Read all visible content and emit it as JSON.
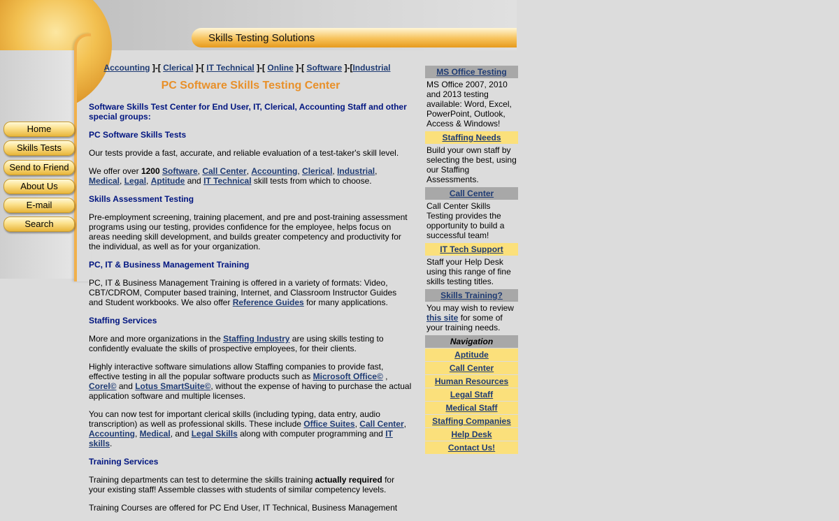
{
  "header": {
    "site_title": "Skills Testing Solutions"
  },
  "left_nav": [
    "Home",
    "Skills Tests",
    "Send to Friend",
    "About Us",
    "E-mail",
    "Search"
  ],
  "top_nav": {
    "items": [
      "Accounting",
      "Clerical",
      "IT Technical",
      "Online",
      "Software",
      "Industrial"
    ],
    "sep_open": "]-[",
    "sep_last": "]-["
  },
  "main": {
    "title": "PC Software Skills Testing Center",
    "intro_heading": "Software Skills Test Center for End User, IT, Clerical, Accounting Staff and other special groups:",
    "sec1_heading": "PC Software Skills Tests",
    "sec1_p1": "Our tests provide a fast, accurate, and reliable evaluation of a test-taker's skill level.",
    "sec1_p2_pre": "We offer over ",
    "sec1_p2_count": "1200",
    "sec1_p2_links": [
      "Software",
      "Call Center",
      "Accounting",
      "Clerical",
      "Industrial",
      "Medical",
      "Legal",
      "Aptitude"
    ],
    "sec1_p2_and": " and ",
    "sec1_p2_it": "IT Technical",
    "sec1_p2_post": " skill tests from which to choose.",
    "sec2_heading": "Skills Assessment Testing",
    "sec2_p": "Pre-employment screening, training placement, and pre and post-training assessment programs using our testing, provides confidence for the employee, helps focus on areas needing skill development, and builds greater competency and productivity for the individual, as well as for your organization.",
    "sec3_heading": "PC, IT & Business Management Training",
    "sec3_p_pre": "PC, IT & Business Management Training is offered in a variety of formats: Video, CBT/CDROM, Computer based training, Internet, and Classroom Instructor Guides and Student workbooks. We also offer ",
    "sec3_link": "Reference Guides",
    "sec3_p_post": " for many applications.",
    "sec4_heading": "Staffing Services",
    "sec4_p1_pre": "More and more organizations in the ",
    "sec4_p1_link": "Staffing Industry",
    "sec4_p1_post": " are using skills testing to confidently evaluate the skills of prospective employees, for their clients.",
    "sec4_p2_pre": "Highly interactive software simulations allow Staffing companies to provide fast, effective testing in all the popular software products such as ",
    "sec4_p2_link1": "Microsoft Office©",
    "sec4_p2_mid1": " ,",
    "sec4_p2_link2": "Corel©",
    "sec4_p2_mid2": " and ",
    "sec4_p2_link3": "Lotus SmartSuite©",
    "sec4_p2_post": ", without the expense of having to purchase the actual application software and multiple licenses.",
    "sec4_p3_pre": "You can now test for important clerical skills (including typing, data entry, audio transcription) as well as professional skills. These include ",
    "sec4_p3_links": [
      "Office Suites",
      "Call Center",
      "Accounting",
      "Medical",
      "Legal Skills",
      "IT skills"
    ],
    "sec4_p3_mid": " along with computer programming and ",
    "sec5_heading": "Training Services",
    "sec5_p1_pre": "Training departments can test to determine the skills training ",
    "sec5_p1_bold": "actually required",
    "sec5_p1_post": " for your existing staff! Assemble classes with students of similar competency levels.",
    "sec5_p2": "Training Courses are offered for PC End User, IT Technical, Business Management"
  },
  "sidebar": {
    "blocks": [
      {
        "title": "MS Office Testing",
        "style": "gray",
        "text": "MS Office 2007, 2010 and 2013 testing available:  Word, Excel, PowerPoint, Outlook, Access & Windows!"
      },
      {
        "title": "Staffing Needs",
        "style": "yellow",
        "text": "Build your own staff by selecting the best, using our Staffing Assessments."
      },
      {
        "title": "Call Center",
        "style": "gray",
        "text": "Call Center Skills Testing provides the opportunity to build a successful team!"
      },
      {
        "title": "IT Tech Support",
        "style": "yellow",
        "text": "Staff your Help Desk using this range of fine skills testing titles."
      },
      {
        "title": "Skills Training?",
        "style": "gray",
        "text_pre": "You may wish to review ",
        "link": "this site",
        "text_post": " for some of your training needs."
      }
    ],
    "nav_heading": "Navigation",
    "nav_items": [
      "Aptitude",
      "Call Center",
      "Human Resources",
      "Legal Staff",
      "Medical Staff",
      "Staffing Companies",
      "Help Desk",
      "Contact Us!"
    ]
  }
}
